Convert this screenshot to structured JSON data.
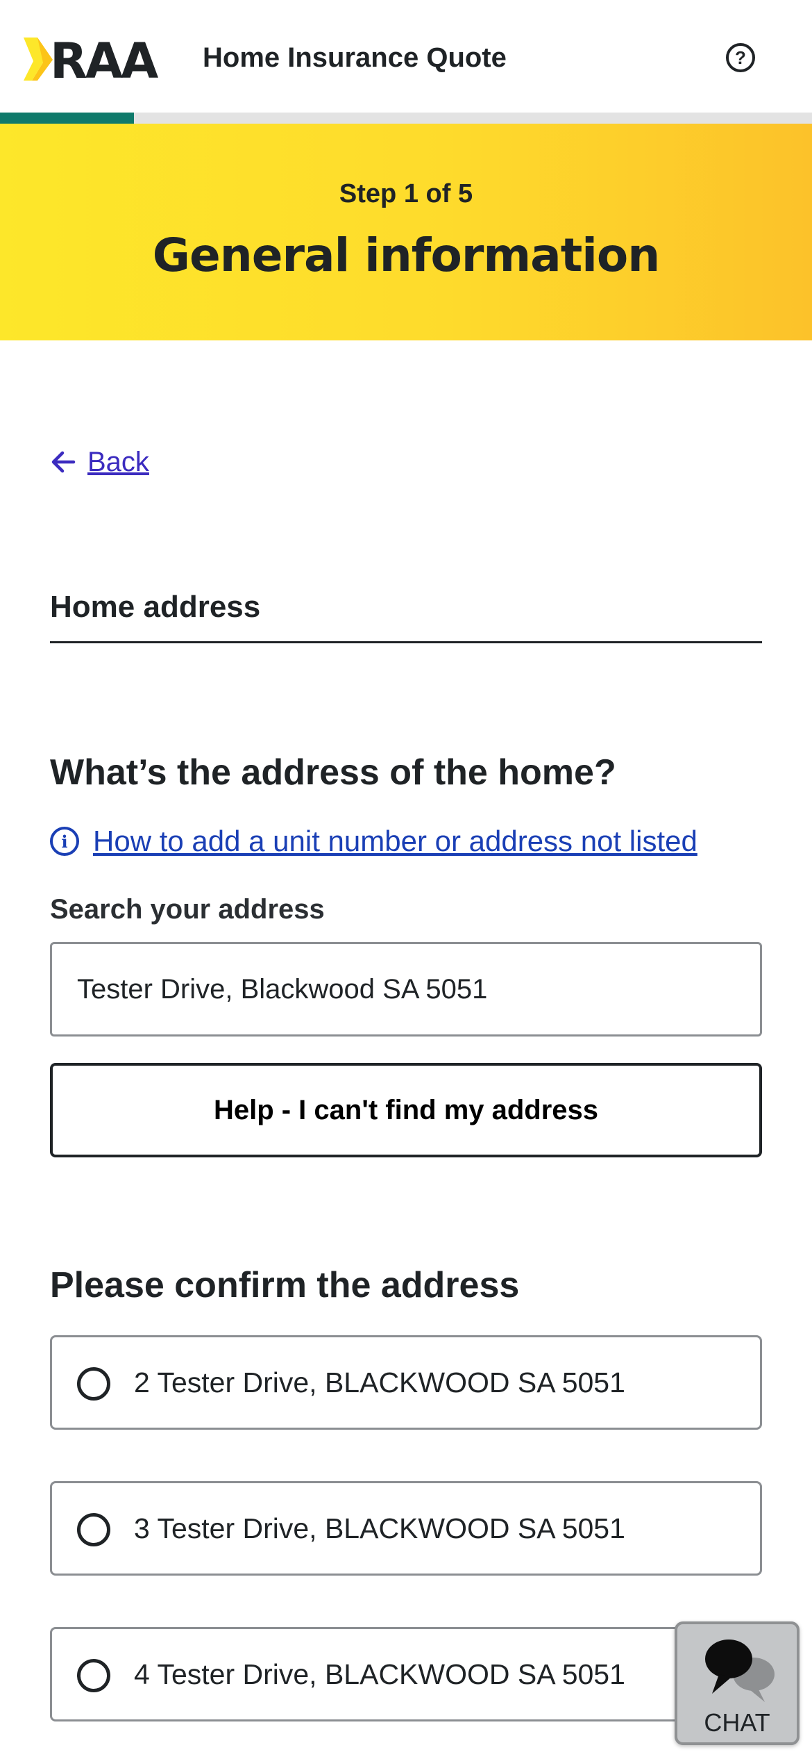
{
  "header": {
    "logo_text": "RAA",
    "title": "Home Insurance Quote",
    "help_icon": "question-circle-icon"
  },
  "progress": {
    "fraction": 0.165,
    "color": "#0f7a6b"
  },
  "banner": {
    "step": "Step 1 of 5",
    "title": "General information"
  },
  "back": {
    "label": "Back",
    "icon": "arrow-left-icon"
  },
  "section": {
    "title": "Home address"
  },
  "question": {
    "title": "What’s the address of the home?",
    "info_link": "How to add a unit number or address not listed",
    "info_icon": "info-icon"
  },
  "search": {
    "label": "Search your address",
    "value": "Tester Drive, Blackwood SA 5051"
  },
  "help_button": {
    "label": "Help - I can't find my address"
  },
  "confirm": {
    "title": "Please confirm the address",
    "options": [
      {
        "label": "2 Tester Drive, BLACKWOOD SA 5051",
        "selected": false
      },
      {
        "label": "3 Tester Drive, BLACKWOOD SA 5051",
        "selected": false
      },
      {
        "label": "4 Tester Drive, BLACKWOOD SA 5051",
        "selected": false
      }
    ]
  },
  "chat": {
    "label": "CHAT",
    "icon": "chat-bubbles-icon"
  },
  "colors": {
    "brand_yellow": "#fde72a",
    "link_blue": "#1a3fb5",
    "back_purple": "#3b2bbf",
    "progress_teal": "#0f7a6b"
  }
}
